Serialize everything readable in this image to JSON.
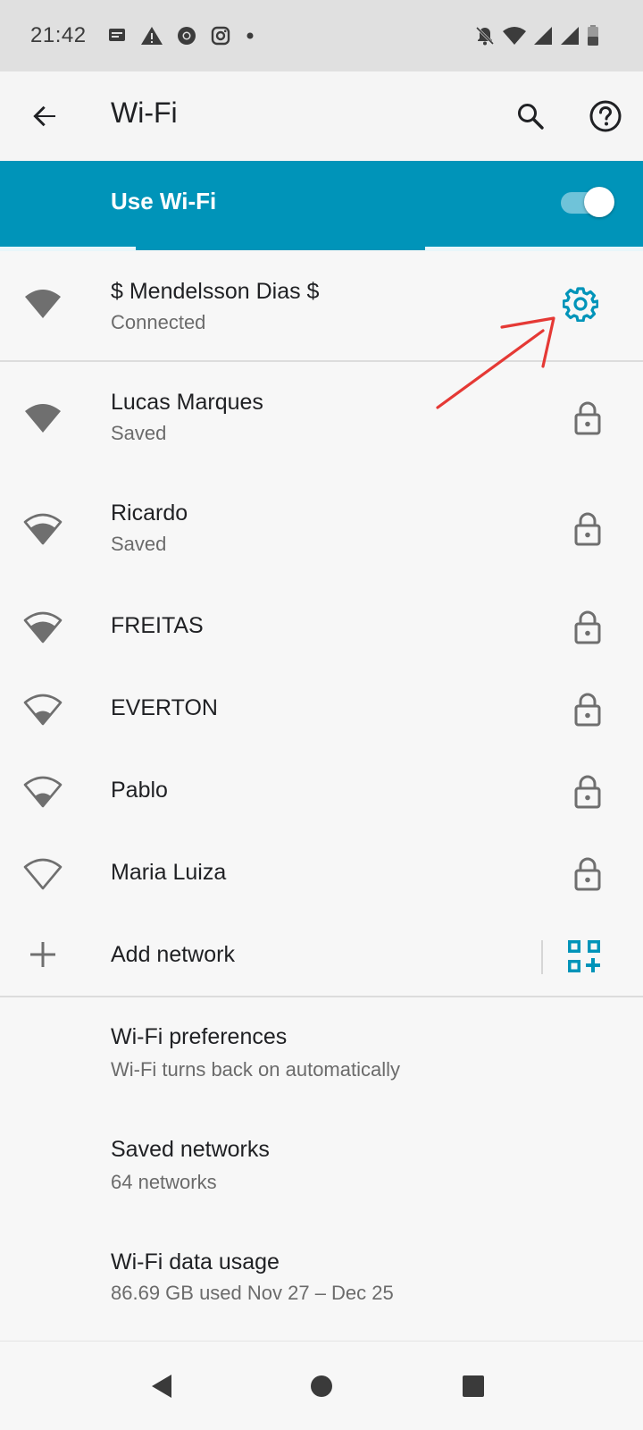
{
  "status_bar": {
    "time": "21:42",
    "left_icons": [
      "message-icon",
      "warning-icon",
      "chrome-icon",
      "instagram-icon",
      "dot-icon"
    ],
    "right_icons": [
      "bell-off-icon",
      "wifi-signal-icon",
      "cell-signal-icon",
      "cell-signal-icon",
      "battery-icon"
    ]
  },
  "app_bar": {
    "title": "Wi-Fi",
    "back_icon": "arrow-back-icon",
    "search_icon": "search-icon",
    "help_icon": "help-icon"
  },
  "wifi_toggle": {
    "label": "Use Wi-Fi",
    "enabled": true
  },
  "connected_network": {
    "name": "$ Mendelsson Dias $",
    "status": "Connected",
    "settings_icon": "gear-icon"
  },
  "networks": [
    {
      "name": "Lucas Marques",
      "status": "Saved",
      "signal": 4,
      "secured": true
    },
    {
      "name": "Ricardo",
      "status": "Saved",
      "signal": 3,
      "secured": true
    },
    {
      "name": "FREITAS",
      "status": "",
      "signal": 3,
      "secured": true
    },
    {
      "name": "EVERTON",
      "status": "",
      "signal": 2,
      "secured": true
    },
    {
      "name": "Pablo",
      "status": "",
      "signal": 2,
      "secured": true
    },
    {
      "name": "Maria Luiza",
      "status": "",
      "signal": 1,
      "secured": true
    }
  ],
  "add_network": {
    "label": "Add network",
    "icon": "plus-icon",
    "qr_icon": "qr-code-add-icon"
  },
  "preferences": [
    {
      "title": "Wi-Fi preferences",
      "subtitle": "Wi-Fi turns back on automatically"
    },
    {
      "title": "Saved networks",
      "subtitle": "64 networks"
    },
    {
      "title": "Wi-Fi data usage",
      "subtitle": "86.69 GB used Nov 27 – Dec 25"
    }
  ],
  "colors": {
    "accent": "#0094b9",
    "annotation": "#e53935",
    "icon_gray": "#6f6f6f"
  },
  "nav_bar": {
    "back_icon": "nav-back-icon",
    "home_icon": "nav-home-icon",
    "recents_icon": "nav-recents-icon"
  }
}
